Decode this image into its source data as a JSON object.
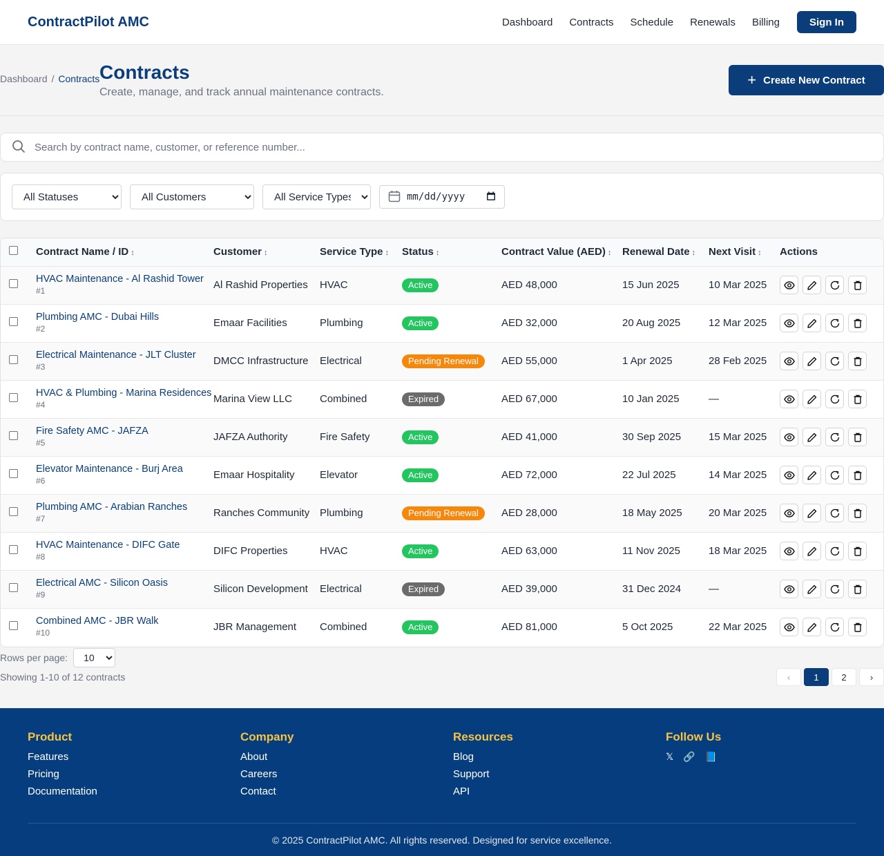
{
  "header": {
    "brand": "ContractPilot AMC",
    "nav": [
      "Dashboard",
      "Contracts",
      "Schedule",
      "Renewals",
      "Billing"
    ],
    "sign_in": "Sign In"
  },
  "breadcrumb": {
    "root": "Dashboard",
    "sep": "/",
    "current": "Contracts"
  },
  "page": {
    "title": "Contracts",
    "subtitle": "Create, manage, and track annual maintenance contracts.",
    "create_label": "Create New Contract"
  },
  "search": {
    "placeholder": "Search by contract name, customer, or reference number..."
  },
  "filters": {
    "status": "All Statuses",
    "customer": "All Customers",
    "service": "All Service Types",
    "date_placeholder": "mm/dd/yyyy"
  },
  "table": {
    "headers": {
      "name": "Contract Name / ID",
      "customer": "Customer",
      "service": "Service Type",
      "status": "Status",
      "value": "Contract Value (AED)",
      "renewal": "Renewal Date",
      "visit": "Next Visit",
      "actions": "Actions",
      "sort_glyph": "↕"
    },
    "rows": [
      {
        "name": "HVAC Maintenance - Al Rashid Tower",
        "id": "#1",
        "customer": "Al Rashid Properties",
        "service": "HVAC",
        "status": "Active",
        "value": "AED 48,000",
        "renewal": "15 Jun 2025",
        "visit": "10 Mar 2025"
      },
      {
        "name": "Plumbing AMC - Dubai Hills",
        "id": "#2",
        "customer": "Emaar Facilities",
        "service": "Plumbing",
        "status": "Active",
        "value": "AED 32,000",
        "renewal": "20 Aug 2025",
        "visit": "12 Mar 2025"
      },
      {
        "name": "Electrical Maintenance - JLT Cluster",
        "id": "#3",
        "customer": "DMCC Infrastructure",
        "service": "Electrical",
        "status": "Pending Renewal",
        "value": "AED 55,000",
        "renewal": "1 Apr 2025",
        "visit": "28 Feb 2025"
      },
      {
        "name": "HVAC & Plumbing - Marina Residences",
        "id": "#4",
        "customer": "Marina View LLC",
        "service": "Combined",
        "status": "Expired",
        "value": "AED 67,000",
        "renewal": "10 Jan 2025",
        "visit": "—"
      },
      {
        "name": "Fire Safety AMC - JAFZA",
        "id": "#5",
        "customer": "JAFZA Authority",
        "service": "Fire Safety",
        "status": "Active",
        "value": "AED 41,000",
        "renewal": "30 Sep 2025",
        "visit": "15 Mar 2025"
      },
      {
        "name": "Elevator Maintenance - Burj Area",
        "id": "#6",
        "customer": "Emaar Hospitality",
        "service": "Elevator",
        "status": "Active",
        "value": "AED 72,000",
        "renewal": "22 Jul 2025",
        "visit": "14 Mar 2025"
      },
      {
        "name": "Plumbing AMC - Arabian Ranches",
        "id": "#7",
        "customer": "Ranches Community",
        "service": "Plumbing",
        "status": "Pending Renewal",
        "value": "AED 28,000",
        "renewal": "18 May 2025",
        "visit": "20 Mar 2025"
      },
      {
        "name": "HVAC Maintenance - DIFC Gate",
        "id": "#8",
        "customer": "DIFC Properties",
        "service": "HVAC",
        "status": "Active",
        "value": "AED 63,000",
        "renewal": "11 Nov 2025",
        "visit": "18 Mar 2025"
      },
      {
        "name": "Electrical AMC - Silicon Oasis",
        "id": "#9",
        "customer": "Silicon Development",
        "service": "Electrical",
        "status": "Expired",
        "value": "AED 39,000",
        "renewal": "31 Dec 2024",
        "visit": "—"
      },
      {
        "name": "Combined AMC - JBR Walk",
        "id": "#10",
        "customer": "JBR Management",
        "service": "Combined",
        "status": "Active",
        "value": "AED 81,000",
        "renewal": "5 Oct 2025",
        "visit": "22 Mar 2025"
      }
    ],
    "status_colors": {
      "Active": "#22c55e",
      "Pending Renewal": "#f7870b",
      "Expired": "#6b6b6b"
    },
    "row_actions": [
      "eye-icon",
      "pencil-icon",
      "renew-icon",
      "trash-icon"
    ]
  },
  "pagination": {
    "rows_label": "Rows per page:",
    "rows_value": "10",
    "showing": "Showing 1-10 of 12 contracts",
    "prev": "‹",
    "pages": [
      "1",
      "2"
    ],
    "next": "›",
    "current": "1"
  },
  "footer": {
    "columns": [
      {
        "title": "Product",
        "links": [
          "Features",
          "Pricing",
          "Documentation"
        ]
      },
      {
        "title": "Company",
        "links": [
          "About",
          "Careers",
          "Contact"
        ]
      },
      {
        "title": "Resources",
        "links": [
          "Blog",
          "Support",
          "API"
        ]
      }
    ],
    "follow_title": "Follow Us",
    "social": [
      "𝕏",
      "🔗",
      "📘"
    ],
    "copyright": "© 2025 ContractPilot AMC. All rights reserved. Designed for service excellence."
  }
}
